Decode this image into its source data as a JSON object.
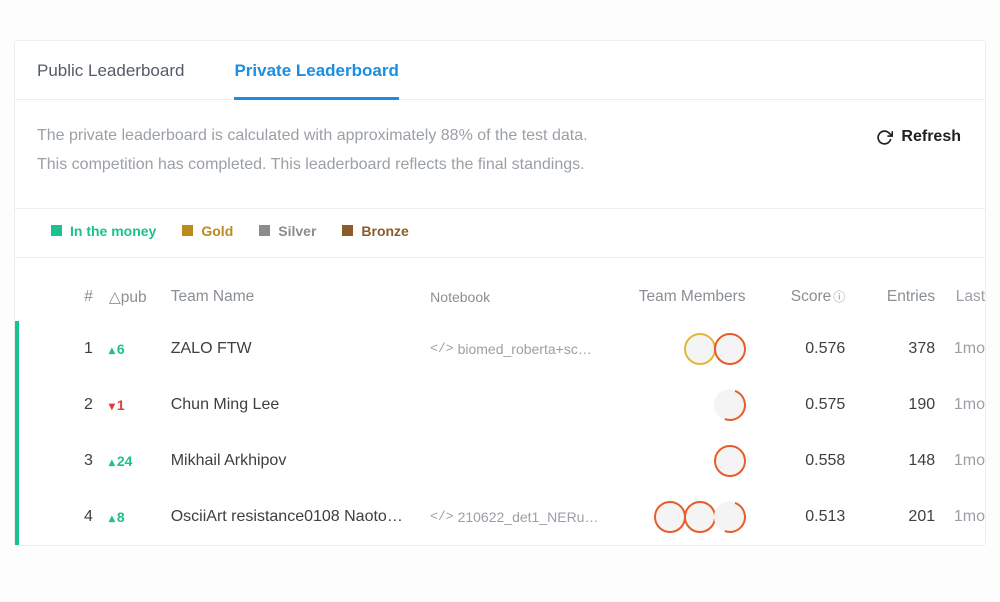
{
  "tabs": {
    "public": "Public Leaderboard",
    "private": "Private Leaderboard"
  },
  "info": {
    "line1": "The private leaderboard is calculated with approximately 88% of the test data.",
    "line2": "This competition has completed. This leaderboard reflects the final standings."
  },
  "refresh_label": "Refresh",
  "legend": {
    "money": "In the money",
    "gold": "Gold",
    "silver": "Silver",
    "bronze": "Bronze"
  },
  "headers": {
    "rank": "#",
    "delta": "△pub",
    "team": "Team Name",
    "notebook": "Notebook",
    "members": "Team Members",
    "score": "Score",
    "entries": "Entries",
    "last": "Last"
  },
  "rows": [
    {
      "rank": "1",
      "delta": "6",
      "delta_dir": "up",
      "team": "ZALO FTW",
      "notebook": "biomed_roberta+sc…",
      "members": 2,
      "score": "0.576",
      "entries": "378",
      "last": "1mo"
    },
    {
      "rank": "2",
      "delta": "1",
      "delta_dir": "down",
      "team": "Chun Ming Lee",
      "notebook": "",
      "members": 1,
      "score": "0.575",
      "entries": "190",
      "last": "1mo"
    },
    {
      "rank": "3",
      "delta": "24",
      "delta_dir": "up",
      "team": "Mikhail Arkhipov",
      "notebook": "",
      "members": 1,
      "score": "0.558",
      "entries": "148",
      "last": "1mo"
    },
    {
      "rank": "4",
      "delta": "8",
      "delta_dir": "up",
      "team": "OsciiArt resistance0108 Naoto…",
      "notebook": "210622_det1_NERu…",
      "members": 3,
      "score": "0.513",
      "entries": "201",
      "last": "1mo"
    }
  ],
  "colors": {
    "money": "#1bc18e",
    "gold": "#bb8b1b",
    "silver": "#8c8c8c",
    "bronze": "#8b5b2a"
  }
}
